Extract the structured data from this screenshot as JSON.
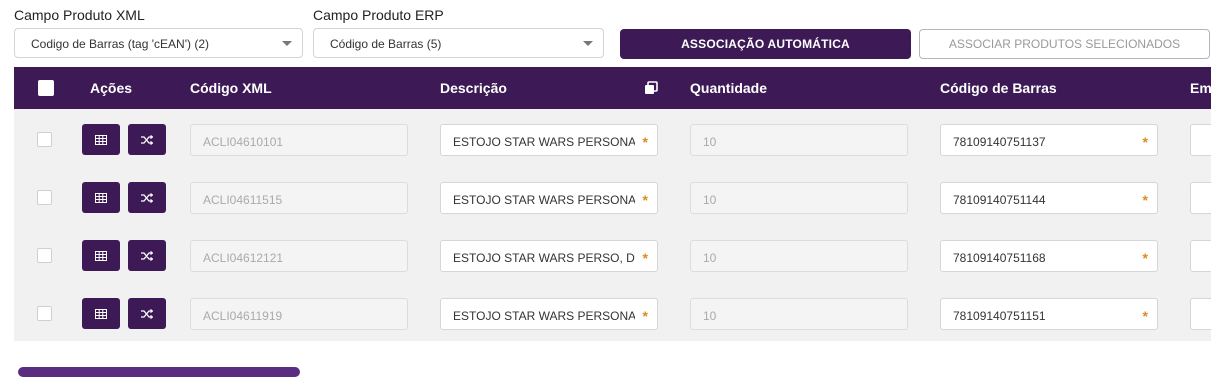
{
  "filters": {
    "xml_label": "Campo Produto XML",
    "xml_value": "Codigo de Barras (tag 'cEAN') (2)",
    "erp_label": "Campo Produto ERP",
    "erp_value": "Código de Barras (5)"
  },
  "actions": {
    "auto_label": "ASSOCIAÇÃO AUTOMÁTICA",
    "selected_label": "ASSOCIAR PRODUTOS SELECIONADOS"
  },
  "table": {
    "columns": {
      "actions": "Ações",
      "xml_code": "Código XML",
      "description": "Descrição",
      "quantity": "Quantidade",
      "barcode": "Código de Barras",
      "cut": "Em"
    },
    "rows": [
      {
        "xml_code": "ACLI04610101",
        "description": "ESTOJO STAR WARS PERSONAGI",
        "quantity": "10",
        "barcode": "78109140751137"
      },
      {
        "xml_code": "ACLI04611515",
        "description": "ESTOJO STAR WARS PERSONAGI",
        "quantity": "10",
        "barcode": "78109140751144"
      },
      {
        "xml_code": "ACLI04612121",
        "description": "ESTOJO STAR WARS PERSO, DOU",
        "quantity": "10",
        "barcode": "78109140751168"
      },
      {
        "xml_code": "ACLI04611919",
        "description": "ESTOJO STAR WARS PERSONA, E",
        "quantity": "10",
        "barcode": "78109140751151"
      }
    ]
  },
  "colors": {
    "primary": "#3d1a56",
    "required": "#e08a1e"
  }
}
